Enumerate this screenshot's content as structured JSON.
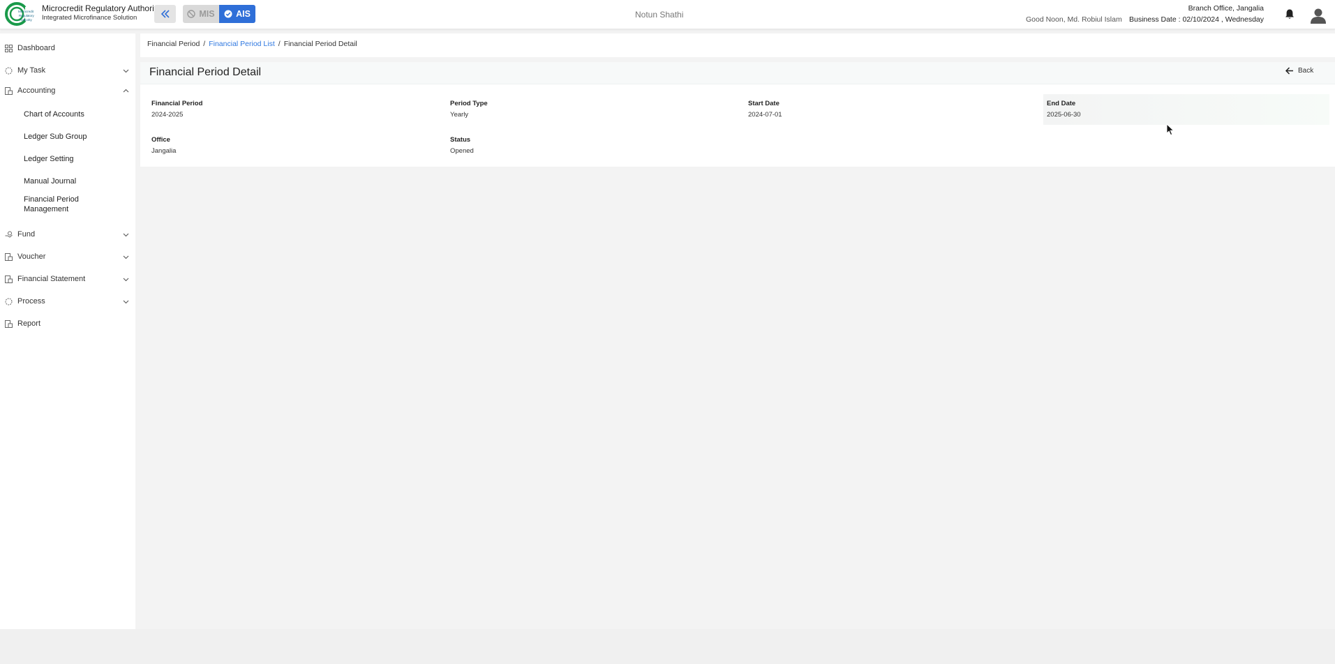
{
  "header": {
    "org_name": "Microcredit Regulatory Authority",
    "org_subtitle": "Integrated Microfinance Solution",
    "logo_text": "Microcredit Regulatory Authority",
    "mode_mis": "MIS",
    "mode_ais": "AIS",
    "center_title": "Notun Shathi",
    "greeting": "Good Noon, Md. Robiul Islam",
    "branch": "Branch Office, Jangalia",
    "business_date": "Business Date : 02/10/2024 , Wednesday",
    "icons": [
      "double-chevron-left-icon",
      "block-icon",
      "check-circle-icon",
      "bell-icon",
      "user-avatar-icon"
    ],
    "colors": {
      "accent": "#2f6fd8",
      "link": "#2f78e0"
    }
  },
  "sidebar": {
    "items": [
      {
        "label": "Dashboard",
        "icon": "grid-icon"
      },
      {
        "label": "My Task",
        "icon": "task-icon"
      },
      {
        "label": "Accounting",
        "icon": "accounting-icon",
        "expanded": true
      },
      {
        "label": "Fund",
        "icon": "fund-icon"
      },
      {
        "label": "Voucher",
        "icon": "voucher-icon"
      },
      {
        "label": "Financial Statement",
        "icon": "statement-icon"
      },
      {
        "label": "Process",
        "icon": "process-icon"
      },
      {
        "label": "Report",
        "icon": "report-icon"
      }
    ],
    "accounting_sub": [
      "Chart of Accounts",
      "Ledger Sub Group",
      "Ledger Setting",
      "Manual Journal",
      "Financial Period",
      "Management"
    ]
  },
  "breadcrumb": {
    "first": "Financial Period",
    "sep": "/",
    "link": "Financial Period List",
    "current": "Financial Period Detail"
  },
  "detail": {
    "title": "Financial Period Detail",
    "back_label": "Back",
    "fields": [
      {
        "label": "Financial Period",
        "value": "2024-2025"
      },
      {
        "label": "Period Type",
        "value": "Yearly"
      },
      {
        "label": "Start Date",
        "value": "2024-07-01"
      },
      {
        "label": "End Date",
        "value": "2025-06-30"
      },
      {
        "label": "Office",
        "value": "Jangalia"
      },
      {
        "label": "Status",
        "value": "Opened"
      }
    ]
  }
}
